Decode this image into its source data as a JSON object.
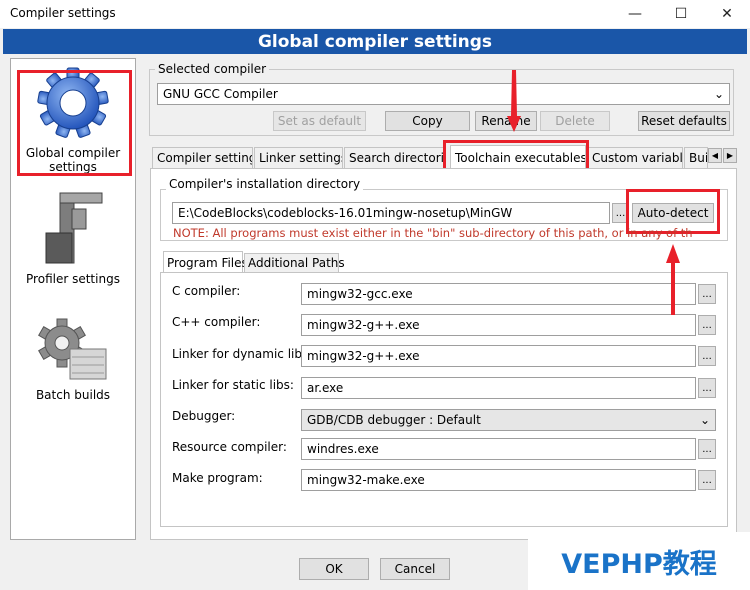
{
  "window": {
    "title": "Compiler settings",
    "minimize": "—",
    "maximize": "☐",
    "close": "✕"
  },
  "header": {
    "title": "Global compiler settings"
  },
  "sidebar": {
    "items": [
      {
        "label": "Global compiler settings",
        "icon": "gear-icon"
      },
      {
        "label": "Profiler settings",
        "icon": "caliper-icon"
      },
      {
        "label": "Batch builds",
        "icon": "gears-stack-icon"
      }
    ]
  },
  "selected_compiler": {
    "group_label": "Selected compiler",
    "value": "GNU GCC Compiler",
    "buttons": {
      "set_default": "Set as default",
      "copy": "Copy",
      "rename": "Rename",
      "delete": "Delete",
      "reset": "Reset defaults"
    }
  },
  "tabs": [
    "Compiler settings",
    "Linker settings",
    "Search directories",
    "Toolchain executables",
    "Custom variables",
    "Bui"
  ],
  "install_dir": {
    "group_label": "Compiler's installation directory",
    "value": "E:\\CodeBlocks\\codeblocks-16.01mingw-nosetup\\MinGW",
    "browse": "...",
    "auto_detect": "Auto-detect",
    "note": "NOTE: All programs must exist either in the \"bin\" sub-directory of this path, or in any of the"
  },
  "inner_tabs": [
    "Program Files",
    "Additional Paths"
  ],
  "programs": [
    {
      "label": "C compiler:",
      "value": "mingw32-gcc.exe",
      "browse": "..."
    },
    {
      "label": "C++ compiler:",
      "value": "mingw32-g++.exe",
      "browse": "..."
    },
    {
      "label": "Linker for dynamic libs:",
      "value": "mingw32-g++.exe",
      "browse": "..."
    },
    {
      "label": "Linker for static libs:",
      "value": "ar.exe",
      "browse": "..."
    },
    {
      "label": "Debugger:",
      "value": "GDB/CDB debugger : Default"
    },
    {
      "label": "Resource compiler:",
      "value": "windres.exe",
      "browse": "..."
    },
    {
      "label": "Make program:",
      "value": "mingw32-make.exe",
      "browse": "..."
    }
  ],
  "footer": {
    "ok": "OK",
    "cancel": "Cancel"
  },
  "watermark": "VEPHP教程",
  "colors": {
    "header": "#1a56a8",
    "highlight": "#e8202a",
    "note": "#c0392b"
  }
}
